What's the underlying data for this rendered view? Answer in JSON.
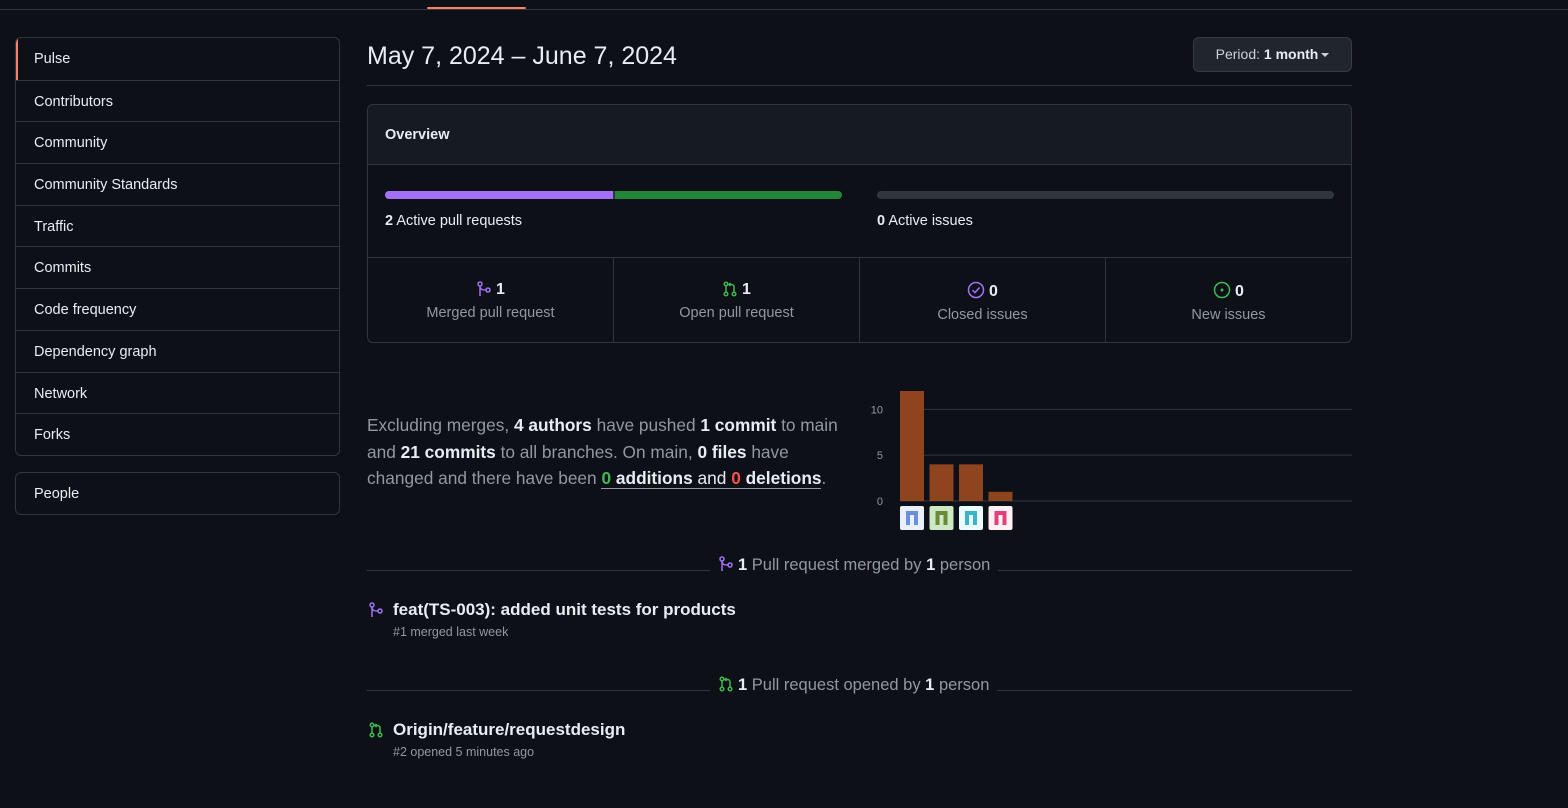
{
  "sidebar": {
    "items": [
      {
        "label": "Pulse"
      },
      {
        "label": "Contributors"
      },
      {
        "label": "Community"
      },
      {
        "label": "Community Standards"
      },
      {
        "label": "Traffic"
      },
      {
        "label": "Commits"
      },
      {
        "label": "Code frequency"
      },
      {
        "label": "Dependency graph"
      },
      {
        "label": "Network"
      },
      {
        "label": "Forks"
      }
    ],
    "selected": "Pulse",
    "people_label": "People"
  },
  "header": {
    "date_range": "May 7, 2024 – June 7, 2024",
    "period_prefix": "Period:",
    "period_value": "1 month"
  },
  "overview": {
    "title": "Overview",
    "pull_requests": {
      "count": "2",
      "label": "Active pull requests",
      "merged_fraction": 0.5,
      "open_fraction": 0.5
    },
    "issues": {
      "count": "0",
      "label": "Active issues"
    },
    "stats": [
      {
        "icon": "git-merge-icon",
        "value": "1",
        "label": "Merged pull request",
        "color": "#a371f7"
      },
      {
        "icon": "git-pull-request-icon",
        "value": "1",
        "label": "Open pull request",
        "color": "#3fb950"
      },
      {
        "icon": "issue-closed-icon",
        "value": "0",
        "label": "Closed issues",
        "color": "#a371f7"
      },
      {
        "icon": "issue-opened-icon",
        "value": "0",
        "label": "New issues",
        "color": "#3fb950"
      }
    ]
  },
  "summary": {
    "t1": "Excluding merges,",
    "authors": "4 authors",
    "t2": "have pushed",
    "commits_main": "1 commit",
    "t3": "to main and",
    "commits_all": "21 commits",
    "t4": "to all branches. On main,",
    "files": "0 files",
    "t5": "have changed and there have been",
    "additions_num": "0",
    "additions_word": "additions",
    "t6": "and",
    "deletions_num": "0",
    "deletions_word": "deletions",
    "t7": "."
  },
  "chart_data": {
    "type": "bar",
    "categories": [
      "author-1",
      "author-2",
      "author-3",
      "author-4"
    ],
    "values": [
      12,
      4,
      4,
      1
    ],
    "yticks": [
      0,
      5,
      10
    ],
    "ylim": [
      0,
      12
    ],
    "grid": true,
    "color": "#8f4420"
  },
  "merged_section": {
    "count": "1",
    "t1": "Pull request merged by",
    "people": "1",
    "t2": "person",
    "items": [
      {
        "title": "feat(TS-003): added unit tests for products",
        "meta": "#1 merged last week"
      }
    ]
  },
  "opened_section": {
    "count": "1",
    "t1": "Pull request opened by",
    "people": "1",
    "t2": "person",
    "items": [
      {
        "title": "Origin/feature/requestdesign",
        "meta": "#2 opened 5 minutes ago"
      }
    ]
  },
  "colors": {
    "accent": "#f78166",
    "merged": "#a371f7",
    "open": "#3fb950",
    "deleted": "#f85149"
  }
}
